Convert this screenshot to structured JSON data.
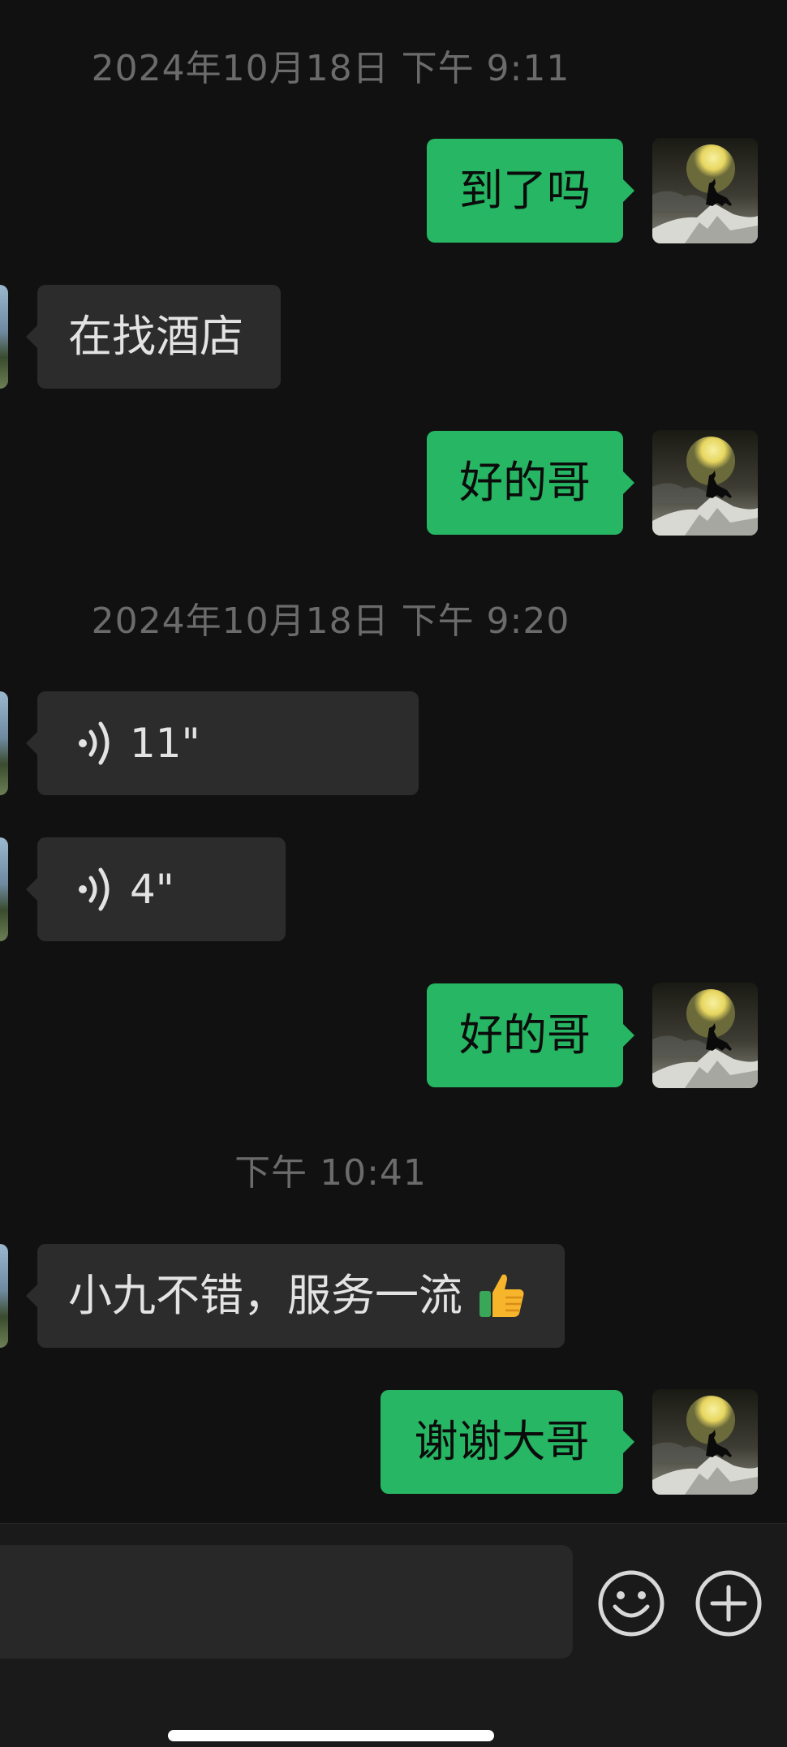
{
  "messages": {
    "ts1": "2024年10月18日 下午 9:11",
    "m1": "到了吗",
    "m2": "在找酒店",
    "m3": "好的哥",
    "ts2": "2024年10月18日 下午 9:20",
    "m4_duration": "11\"",
    "m5_duration": "4\"",
    "m6": "好的哥",
    "ts3": "下午 10:41",
    "m7": "小九不错，服务一流",
    "m8": "谢谢大哥"
  },
  "input": {
    "placeholder": "",
    "icons": [
      "emoji-icon",
      "plus-icon"
    ]
  },
  "colors": {
    "background": "#111111",
    "outgoing_bubble": "#27b663",
    "incoming_bubble": "#2c2c2c",
    "timestamp": "#6b6b6b"
  }
}
